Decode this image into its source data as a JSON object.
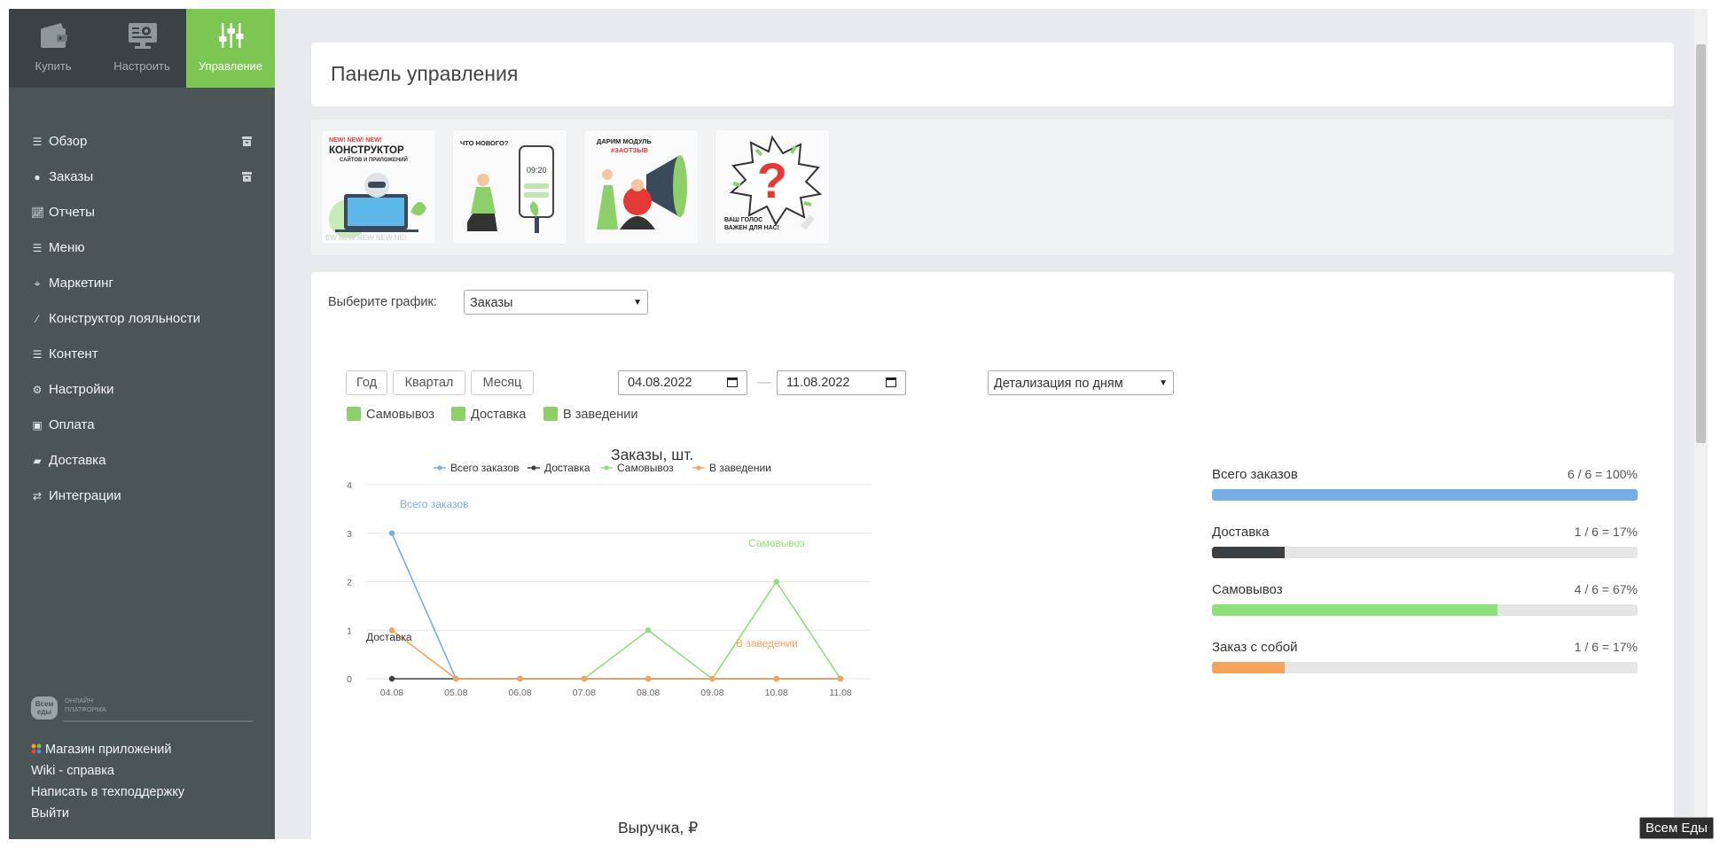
{
  "topnav": {
    "buy": "Купить",
    "setup": "Настроить",
    "manage": "Управление"
  },
  "sidebar": {
    "items": [
      {
        "label": "Обзор",
        "icon": "list-icon"
      },
      {
        "label": "Заказы",
        "icon": "circle-icon"
      },
      {
        "label": "Отчеты",
        "icon": "line-chart-icon"
      },
      {
        "label": "Меню",
        "icon": "list-icon"
      },
      {
        "label": "Маркетинг",
        "icon": "crosshair-icon"
      },
      {
        "label": "Конструктор лояльности",
        "icon": "magic-wand-icon"
      },
      {
        "label": "Контент",
        "icon": "list-icon"
      },
      {
        "label": "Настройки",
        "icon": "gear-icon"
      },
      {
        "label": "Оплата",
        "icon": "money-icon"
      },
      {
        "label": "Доставка",
        "icon": "truck-icon"
      },
      {
        "label": "Интеграции",
        "icon": "exchange-icon"
      }
    ],
    "logo_text": "Всем еды",
    "logo_tagline_1": "ОНЛАЙН",
    "logo_tagline_2": "ПЛАТФОРМА",
    "bottom": {
      "apps": "Магазин приложений",
      "wiki": "Wiki - справка",
      "support": "Написать в техподдержку",
      "logout": "Выйти"
    }
  },
  "header": {
    "title": "Панель управления"
  },
  "banners": [
    {
      "top": "NEW! NEW! NEW!",
      "head": "КОНСТРУКТОР",
      "sub": "САЙТОВ И ПРИЛОЖЕНИЙ",
      "footer": "EW NEW NEW NEW NE!"
    },
    {
      "head": "ЧТО НОВОГО?",
      "time": "09:20"
    },
    {
      "head": "ДАРИМ МОДУЛЬ",
      "tag": "#ЗАОТЗЫВ"
    },
    {
      "head": "ВАШ ГОЛОС",
      "sub": "ВАЖЕН ДЛЯ НАС!"
    }
  ],
  "controls": {
    "select_label": "Выберите график:",
    "select_value": "Заказы",
    "periods": [
      "Год",
      "Квартал",
      "Месяц"
    ],
    "date_from": "04.08.2022",
    "date_to": "11.08.2022",
    "date_sep": "—",
    "detail_value": "Детализация по дням",
    "filters": [
      "Самовывоз",
      "Доставка",
      "В заведении"
    ]
  },
  "colors": {
    "accent": "#7cc653",
    "sidebar": "#4b5457",
    "total": "#74aee4",
    "delivery": "#3c4043",
    "pickup": "#8ee07a",
    "inplace": "#f4a35a"
  },
  "chart_data": {
    "type": "line",
    "title": "Заказы, шт.",
    "categories": [
      "04.08",
      "05.08",
      "06.08",
      "07.08",
      "08.08",
      "09.08",
      "10.08",
      "11.08"
    ],
    "ylim": [
      0,
      4
    ],
    "yticks": [
      "0",
      "1",
      "2",
      "3",
      "4"
    ],
    "legend_position": "top",
    "series": [
      {
        "name": "Всего заказов",
        "color": "#74aee4",
        "values": [
          3,
          0,
          null,
          null,
          null,
          null,
          null,
          null
        ]
      },
      {
        "name": "Доставка",
        "color": "#3c4043",
        "values": [
          0,
          0,
          0,
          0,
          0,
          0,
          0,
          0
        ]
      },
      {
        "name": "Самовывоз",
        "color": "#8ee07a",
        "values": [
          null,
          null,
          null,
          0,
          1,
          0,
          2,
          0
        ]
      },
      {
        "name": "В заведении",
        "color": "#f4a35a",
        "values": [
          1,
          0,
          0,
          0,
          0,
          0,
          0,
          0
        ]
      }
    ],
    "annotations": [
      {
        "text": "Всего заказов",
        "color": "#74aee4"
      },
      {
        "text": "Доставка",
        "color": "#333333"
      },
      {
        "text": "Самовывоз",
        "color": "#8ee07a"
      },
      {
        "text": "В заведении",
        "color": "#f4a35a"
      }
    ]
  },
  "stats": [
    {
      "label": "Всего заказов",
      "value": "6 / 6 = 100%",
      "fraction": 1.0,
      "color": "#74aee4"
    },
    {
      "label": "Доставка",
      "value": "1 / 6 = 17%",
      "fraction": 0.17,
      "color": "#3c4043"
    },
    {
      "label": "Самовывоз",
      "value": "4 / 6 = 67%",
      "fraction": 0.67,
      "color": "#8ee07a"
    },
    {
      "label": "Заказ с собой",
      "value": "1 / 6 = 17%",
      "fraction": 0.17,
      "color": "#f4a35a"
    }
  ],
  "revenue_title": "Выручка, ₽",
  "tooltip": "Всем Еды"
}
